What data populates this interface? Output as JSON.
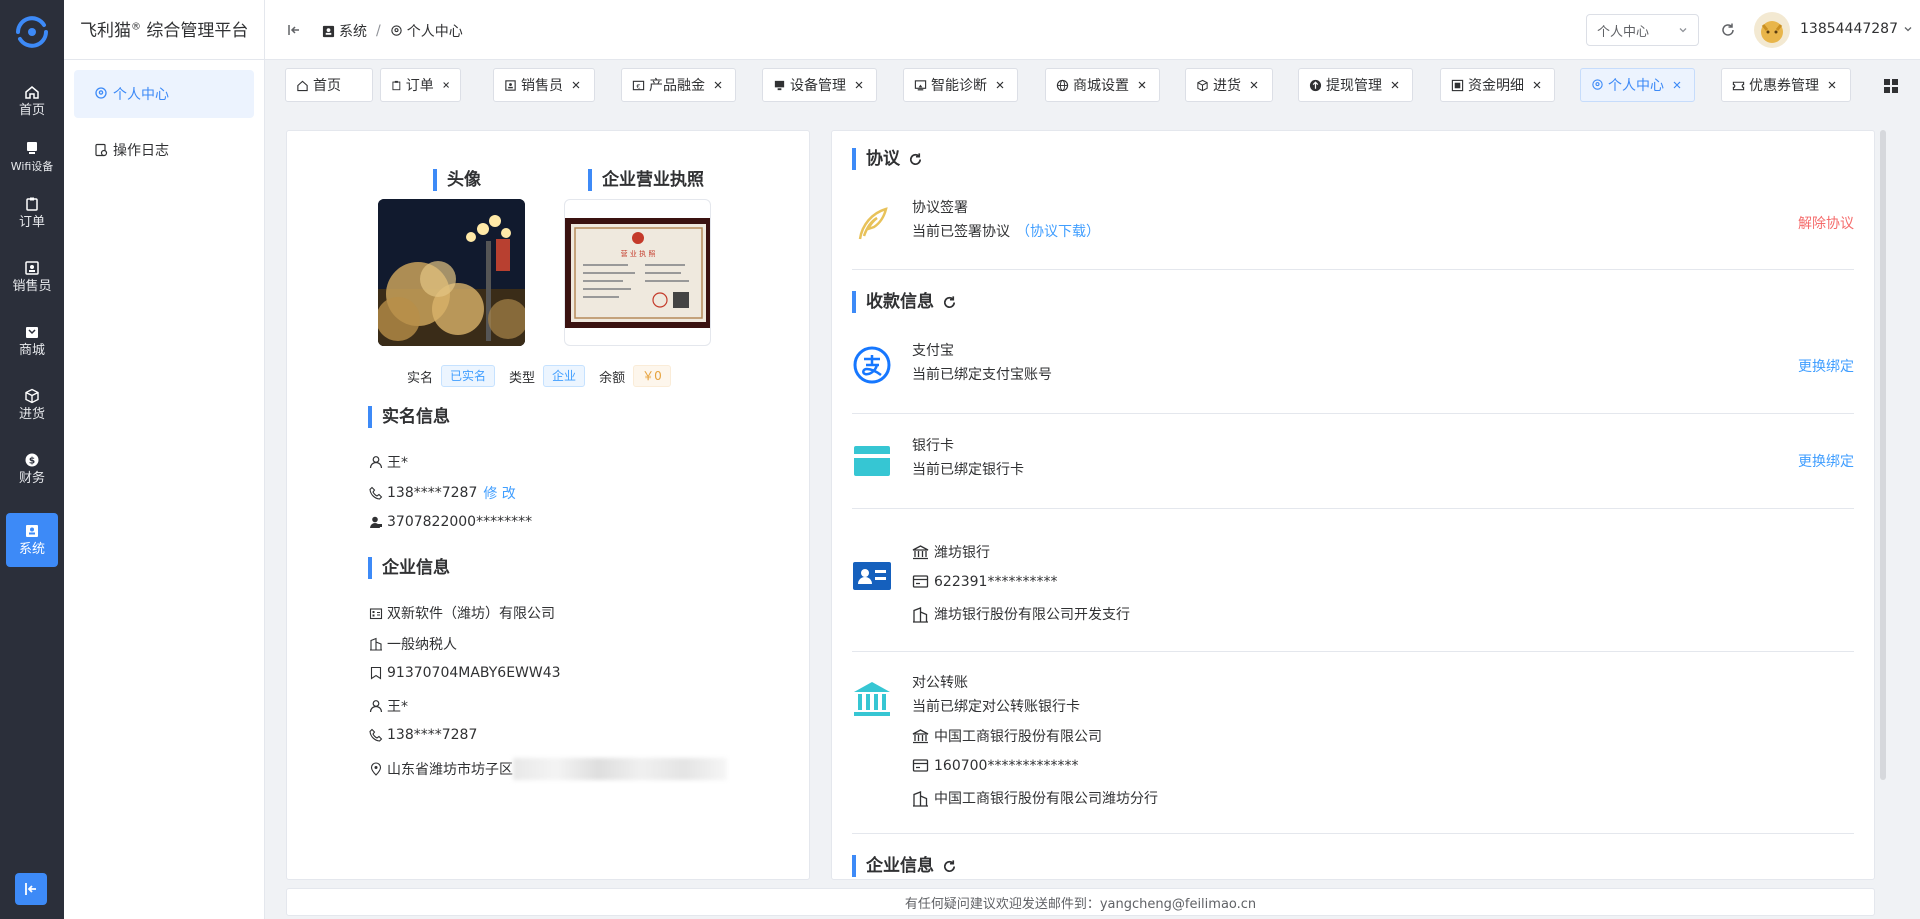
{
  "nav": {
    "items": [
      {
        "label": "首页",
        "icon": "home-icon"
      },
      {
        "label": "Wifi设备",
        "icon": "router-icon"
      },
      {
        "label": "订单",
        "icon": "clipboard-icon"
      },
      {
        "label": "销售员",
        "icon": "id-card-icon"
      },
      {
        "label": "商城",
        "icon": "shop-icon"
      },
      {
        "label": "进货",
        "icon": "box-icon"
      },
      {
        "label": "财务",
        "icon": "money-icon"
      },
      {
        "label": "系统",
        "icon": "system-icon"
      }
    ],
    "active": "系统"
  },
  "header": {
    "brand_name": "飞利猫",
    "brand_mark": "®",
    "brand_suffix": " 综合管理平台",
    "breadcrumb": [
      "系统",
      "个人中心"
    ],
    "page_select": "个人中心",
    "username": "13854447287"
  },
  "sub_sidebar": {
    "items": [
      {
        "label": "个人中心",
        "icon": "location-pin-icon",
        "active": true
      },
      {
        "label": "操作日志",
        "icon": "log-icon",
        "active": false
      }
    ]
  },
  "tabs": [
    {
      "label": "首页",
      "icon": "home-icon",
      "closable": false
    },
    {
      "label": "订单",
      "icon": "clipboard-icon",
      "closable": true
    },
    {
      "label": "销售员",
      "icon": "id-card-icon",
      "closable": true
    },
    {
      "label": "产品融金",
      "icon": "coin-icon",
      "closable": true
    },
    {
      "label": "设备管理",
      "icon": "monitor-icon",
      "closable": true
    },
    {
      "label": "智能诊断",
      "icon": "screen-icon",
      "closable": true
    },
    {
      "label": "商城设置",
      "icon": "globe-icon",
      "closable": true
    },
    {
      "label": "进货",
      "icon": "box-icon",
      "closable": true
    },
    {
      "label": "提现管理",
      "icon": "withdraw-icon",
      "closable": true
    },
    {
      "label": "资金明细",
      "icon": "fund-icon",
      "closable": true
    },
    {
      "label": "个人中心",
      "icon": "location-pin-icon",
      "closable": true,
      "active": true
    },
    {
      "label": "优惠券管理",
      "icon": "coupon-icon",
      "closable": true
    }
  ],
  "profile": {
    "avatar_title": "头像",
    "license_title": "企业营业执照",
    "license_text": "营 业 执 照",
    "realname_label": "实名",
    "realname_tag": "已实名",
    "type_label": "类型",
    "type_tag": "企业",
    "balance_label": "余额",
    "balance_tag": "￥0",
    "realname_section": "实名信息",
    "name": "王*",
    "phone": "138****7287",
    "phone_edit": "修 改",
    "id_number": "3707822000********",
    "company_section": "企业信息",
    "company_name": "双新软件（潍坊）有限公司",
    "taxpayer": "一般纳税人",
    "credit_code": "91370704MABY6EWW43",
    "contact": "王*",
    "contact_phone": "138****7287",
    "address": "山东省潍坊市坊子区"
  },
  "right": {
    "agreement_title": "协议",
    "agreement_name": "协议签署",
    "agreement_status": "当前已签署协议",
    "agreement_download": "（协议下载）",
    "agreement_action": "解除协议",
    "payment_title": "收款信息",
    "alipay_name": "支付宝",
    "alipay_status": "当前已绑定支付宝账号",
    "alipay_action": "更换绑定",
    "bank_name": "银行卡",
    "bank_status": "当前已绑定银行卡",
    "bank_action": "更换绑定",
    "bank_detail_name": "潍坊银行",
    "bank_detail_number": "622391**********",
    "bank_detail_branch": "潍坊银行股份有限公司开发支行",
    "corp_name": "对公转账",
    "corp_status": "当前已绑定对公转账银行卡",
    "corp_bank": "中国工商银行股份有限公司",
    "corp_number": "160700*************",
    "corp_branch": "中国工商银行股份有限公司潍坊分行",
    "company_title": "企业信息"
  },
  "footer": {
    "text": "有任何疑问建议欢迎发送邮件到：yangcheng@feilimao.cn"
  },
  "colors": {
    "primary": "#3d8af7",
    "danger": "#f56c6c",
    "rail": "#2b2f3a",
    "alipay": "#1677ff",
    "bank_card": "#36c6d3",
    "agreement": "#e8c25a"
  }
}
